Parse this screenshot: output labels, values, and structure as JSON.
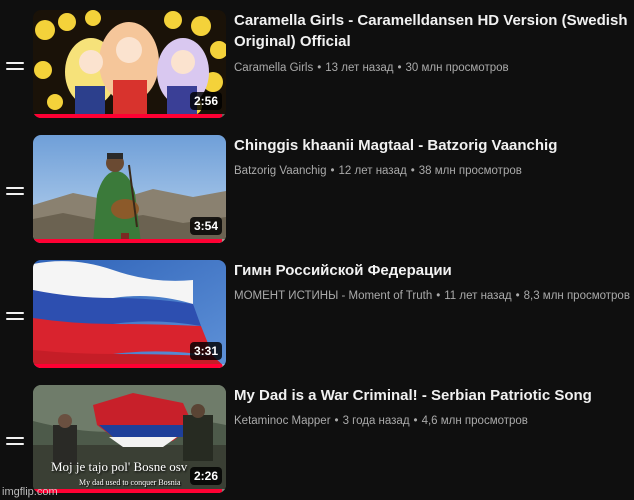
{
  "playlist": {
    "items": [
      {
        "title": "Caramella Girls - Caramelldansen HD Version (Swedish Original) Official",
        "channel": "Caramella Girls",
        "age": "13 лет назад",
        "views": "30 млн просмотров",
        "duration": "2:56",
        "watched_fraction": 0.98
      },
      {
        "title": "Chinggis khaanii Magtaal - Batzorig Vaanchig",
        "channel": "Batzorig Vaanchig",
        "age": "12 лет назад",
        "views": "38 млн просмотров",
        "duration": "3:54",
        "watched_fraction": 0.98
      },
      {
        "title": "Гимн Российской Федерации",
        "channel": "МОМЕНТ ИСТИНЫ - Moment of Truth",
        "age": "11 лет назад",
        "views": "8,3 млн просмотров",
        "duration": "3:31",
        "watched_fraction": 0.98
      },
      {
        "title": "My Dad is a War Criminal! - Serbian Patriotic Song",
        "channel": "Ketaminoc Mapper",
        "age": "3 года назад",
        "views": "4,6 млн просмотров",
        "duration": "2:26",
        "watched_fraction": 0.98,
        "thumb_caption": "Moj je tajo pol' Bosne osv",
        "thumb_subcaption": "My dad used to conquer Bosnia"
      }
    ],
    "separator": "•"
  },
  "watermark": "imgflip.com",
  "colors": {
    "background": "#0f0f0f",
    "progress": "#ff0033",
    "meta_text": "#aaaaaa"
  }
}
